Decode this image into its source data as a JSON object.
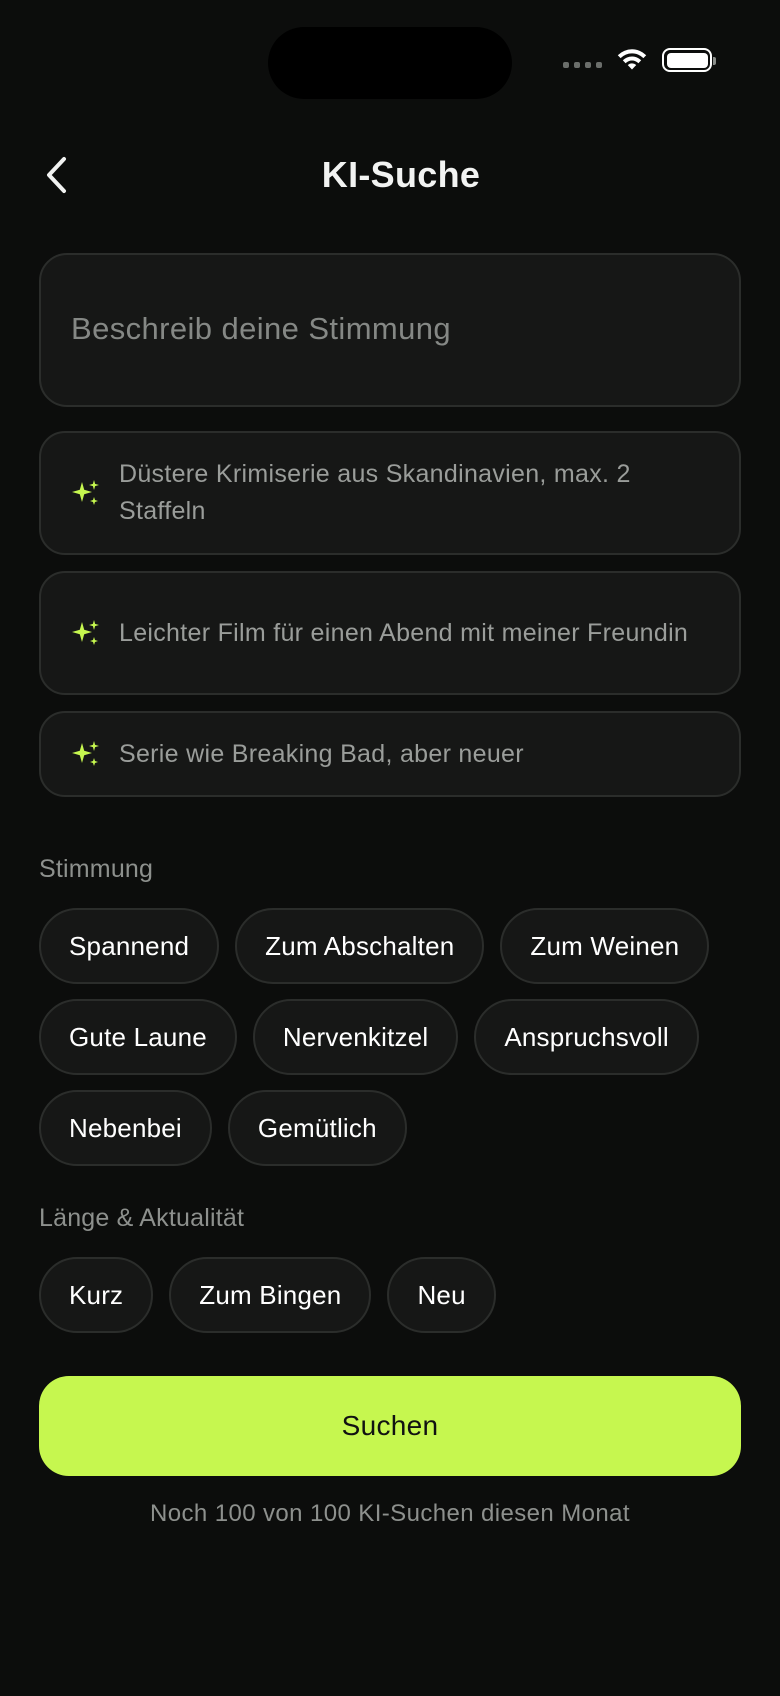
{
  "header": {
    "title": "KI-Suche"
  },
  "search": {
    "placeholder": "Beschreib deine Stimmung",
    "value": ""
  },
  "suggestions": [
    {
      "icon": "sparkle-icon",
      "text": "Düstere Krimiserie aus Skandinavien, max. 2 Staffeln"
    },
    {
      "icon": "sparkle-icon",
      "text": "Leichter Film für einen Abend mit meiner Freundin"
    },
    {
      "icon": "sparkle-icon",
      "text": "Serie wie Breaking Bad, aber neuer"
    }
  ],
  "mood": {
    "label": "Stimmung",
    "chips": [
      "Spannend",
      "Zum Abschalten",
      "Zum Weinen",
      "Gute Laune",
      "Nervenkitzel",
      "Anspruchsvoll",
      "Nebenbei",
      "Gemütlich"
    ]
  },
  "length": {
    "label": "Länge & Aktualität",
    "chips": [
      "Kurz",
      "Zum Bingen",
      "Neu"
    ]
  },
  "actions": {
    "search_label": "Suchen"
  },
  "quota": {
    "text": "Noch 100 von 100 KI-Suchen diesen Monat"
  },
  "colors": {
    "background": "#0c0d0c",
    "surface": "#161716",
    "border": "#2b2d2b",
    "accent": "#c6f74f",
    "muted_text": "#8d908d"
  }
}
